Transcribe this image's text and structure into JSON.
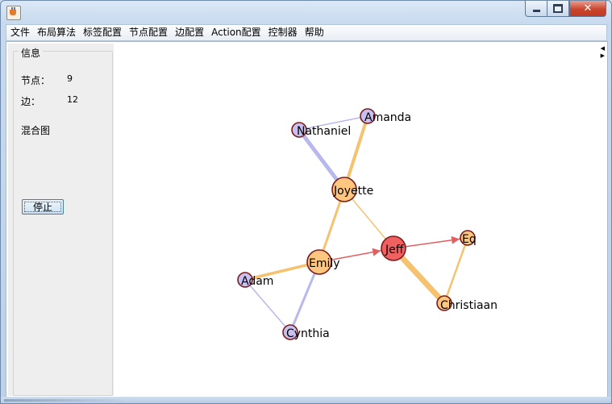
{
  "window": {
    "title": "",
    "buttons": {
      "minimize_icon": "minimize-icon",
      "maximize_icon": "maximize-icon",
      "close_icon": "close-icon",
      "close_glyph": "✕"
    }
  },
  "menubar": {
    "items": [
      "文件",
      "布局算法",
      "标签配置",
      "节点配置",
      "边配置",
      "Action配置",
      "控制器",
      "帮助"
    ]
  },
  "info_panel": {
    "title": "信息",
    "nodes_label": "节点：",
    "nodes_value": "9",
    "edges_label": "边：",
    "edges_value": "12",
    "graph_type": "混合图",
    "stop_button": "停止"
  },
  "graph": {
    "colors": {
      "orange": "#ffc680",
      "purple": "#c8c0f0",
      "red": "#f06060",
      "edge_orange": "#f5c270",
      "edge_purple": "#b8b8ee",
      "edge_red": "#e06060"
    },
    "nodes": [
      {
        "id": "Nathaniel",
        "label": "Nathaniel",
        "color": "purple"
      },
      {
        "id": "Amanda",
        "label": "Amanda",
        "color": "purple"
      },
      {
        "id": "Joyette",
        "label": "Joyette",
        "color": "orange"
      },
      {
        "id": "Jeff",
        "label": "Jeff",
        "color": "red"
      },
      {
        "id": "Eq",
        "label": "Eq",
        "color": "orange"
      },
      {
        "id": "Emily",
        "label": "Emily",
        "color": "orange"
      },
      {
        "id": "Adam",
        "label": "Adam",
        "color": "purple"
      },
      {
        "id": "Christiaan",
        "label": "Christiaan",
        "color": "orange"
      },
      {
        "id": "Cynthia",
        "label": "Cynthia",
        "color": "purple"
      }
    ],
    "edges": [
      {
        "from": "Nathaniel",
        "to": "Amanda",
        "color": "edge_purple"
      },
      {
        "from": "Nathaniel",
        "to": "Joyette",
        "color": "edge_purple"
      },
      {
        "from": "Amanda",
        "to": "Joyette",
        "color": "edge_orange"
      },
      {
        "from": "Joyette",
        "to": "Jeff",
        "color": "edge_orange"
      },
      {
        "from": "Joyette",
        "to": "Emily",
        "color": "edge_orange"
      },
      {
        "from": "Emily",
        "to": "Adam",
        "color": "edge_orange"
      },
      {
        "from": "Emily",
        "to": "Cynthia",
        "color": "edge_purple"
      },
      {
        "from": "Adam",
        "to": "Cynthia",
        "color": "edge_purple"
      },
      {
        "from": "Emily",
        "to": "Jeff",
        "color": "edge_red",
        "directed": true
      },
      {
        "from": "Jeff",
        "to": "Eq",
        "color": "edge_red",
        "directed": true
      },
      {
        "from": "Jeff",
        "to": "Christiaan",
        "color": "edge_orange"
      },
      {
        "from": "Eq",
        "to": "Christiaan",
        "color": "edge_orange"
      }
    ]
  }
}
